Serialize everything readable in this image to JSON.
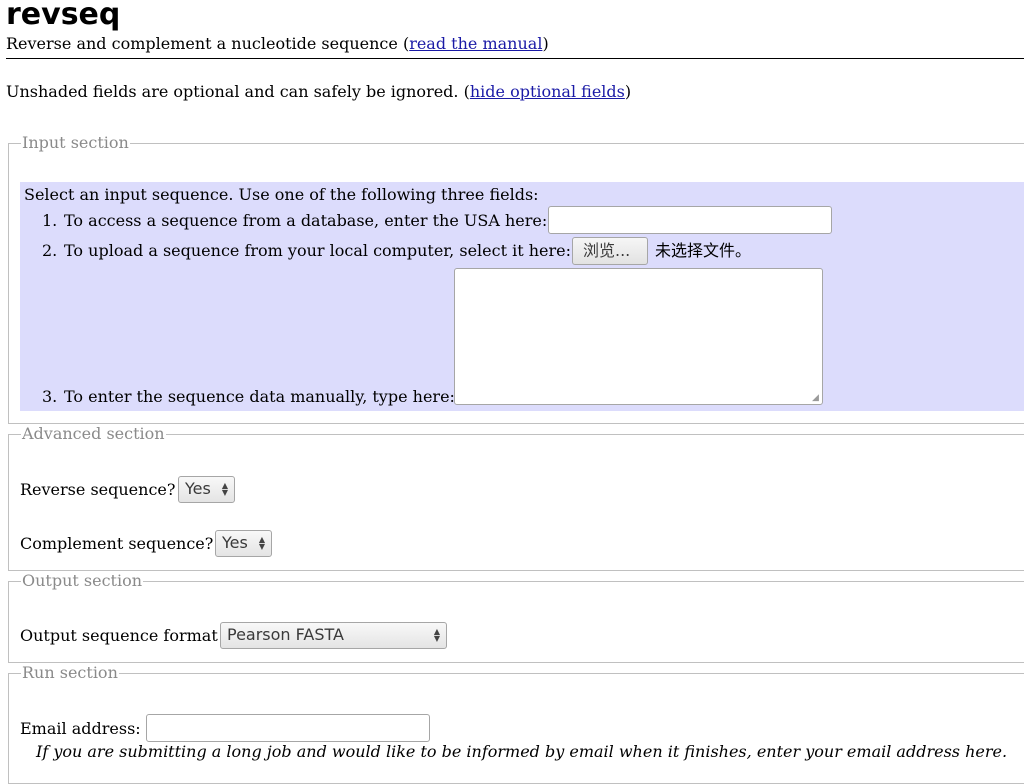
{
  "header": {
    "title": "revseq",
    "subtitle_prefix": "Reverse and complement a nucleotide sequence (",
    "manual_link": "read the manual",
    "subtitle_suffix": ")"
  },
  "notice": {
    "prefix": "Unshaded fields are optional and can safely be ignored. (",
    "link": "hide optional fields",
    "suffix": ")"
  },
  "input_section": {
    "legend": "Input section",
    "intro": "Select an input sequence. Use one of the following three fields:",
    "items": [
      {
        "num": "1.",
        "label": "To access a sequence from a database, enter the USA here:",
        "value": ""
      },
      {
        "num": "2.",
        "label": "To upload a sequence from your local computer, select it here:",
        "browse_label": "浏览...",
        "file_status": "未选择文件。"
      },
      {
        "num": "3.",
        "label": "To enter the sequence data manually, type here:",
        "value": ""
      }
    ],
    "color": "#dcdcfc"
  },
  "advanced_section": {
    "legend": "Advanced section",
    "reverse_label": "Reverse sequence?",
    "reverse_value": "Yes",
    "complement_label": "Complement sequence?",
    "complement_value": "Yes"
  },
  "output_section": {
    "legend": "Output section",
    "format_label": "Output sequence format",
    "format_value": "Pearson FASTA"
  },
  "run_section": {
    "legend": "Run section",
    "email_label": "Email address:",
    "email_value": "",
    "email_hint": "If you are submitting a long job and would like to be informed by email when it finishes, enter your email address here."
  },
  "icons": {
    "select_arrows": "updown-chevron-icon",
    "textarea_grip": "resize-grip-icon"
  }
}
